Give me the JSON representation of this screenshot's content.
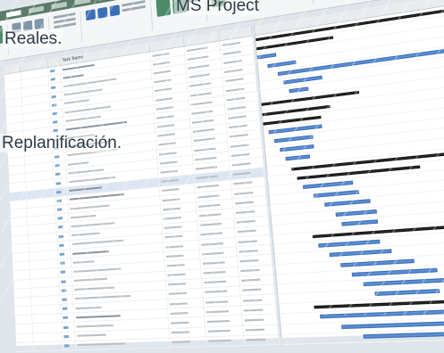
{
  "captions": {
    "title": "MS Project",
    "line2": "Reales.",
    "line3": "Replanificación."
  },
  "columns": {
    "task_name": "Task Name"
  },
  "rows": [
    {
      "selected": false,
      "summary": true
    },
    {
      "selected": false,
      "summary": true
    },
    {
      "selected": false,
      "summary": false
    },
    {
      "selected": false,
      "summary": false
    },
    {
      "selected": false,
      "summary": false
    },
    {
      "selected": false,
      "summary": false
    },
    {
      "selected": false,
      "summary": false
    },
    {
      "selected": false,
      "summary": true
    },
    {
      "selected": false,
      "summary": true
    },
    {
      "selected": false,
      "summary": true
    },
    {
      "selected": false,
      "summary": false
    },
    {
      "selected": false,
      "summary": false
    },
    {
      "selected": false,
      "summary": false
    },
    {
      "selected": false,
      "summary": false
    },
    {
      "selected": true,
      "summary": true
    },
    {
      "selected": false,
      "summary": true
    },
    {
      "selected": false,
      "summary": false
    },
    {
      "selected": false,
      "summary": false
    },
    {
      "selected": false,
      "summary": false
    },
    {
      "selected": false,
      "summary": false
    },
    {
      "selected": false,
      "summary": false
    },
    {
      "selected": false,
      "summary": true
    },
    {
      "selected": false,
      "summary": false
    },
    {
      "selected": false,
      "summary": false
    },
    {
      "selected": false,
      "summary": false
    },
    {
      "selected": false,
      "summary": false
    },
    {
      "selected": false,
      "summary": false
    },
    {
      "selected": false,
      "summary": false
    },
    {
      "selected": false,
      "summary": true
    },
    {
      "selected": false,
      "summary": false
    },
    {
      "selected": false,
      "summary": false
    },
    {
      "selected": false,
      "summary": false
    }
  ],
  "colors": {
    "ribbon_accent": "#5a7a6a",
    "task_bar": "#5b8fd6",
    "summary_bar": "#2d2d2d",
    "selected_row": "#dbe6f2"
  }
}
